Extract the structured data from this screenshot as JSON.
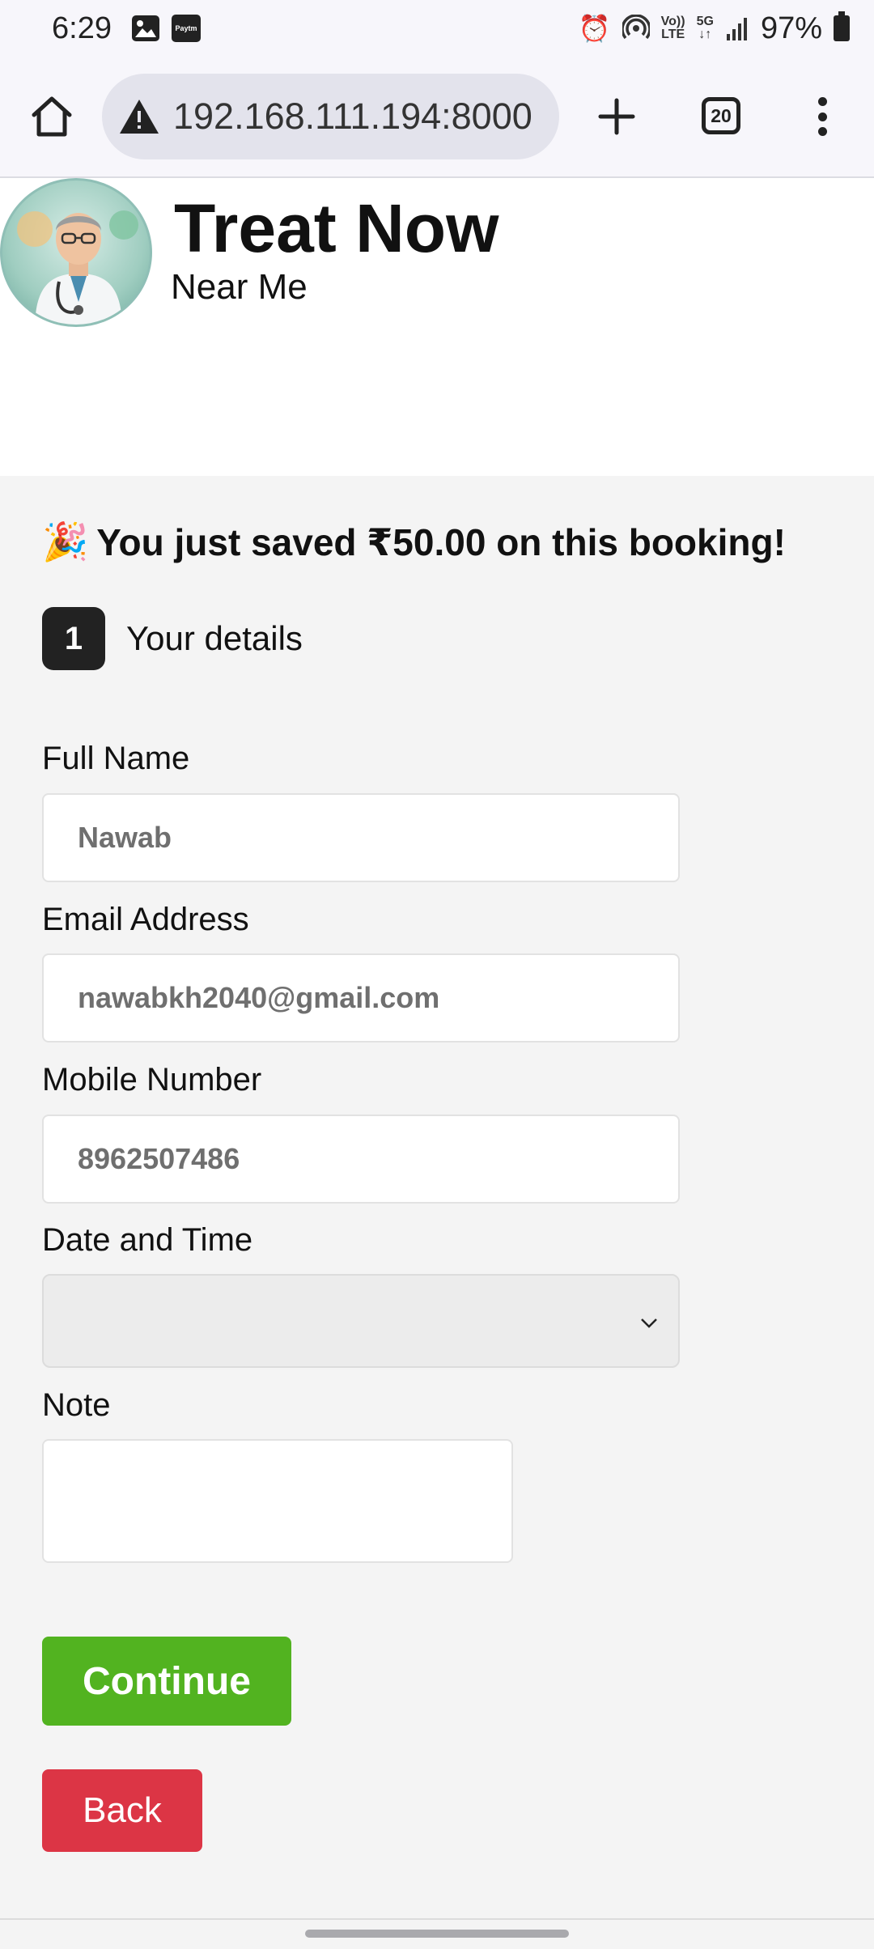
{
  "status_bar": {
    "time": "6:29",
    "icons_left": [
      "image-icon",
      "paytm-icon"
    ],
    "paytm_label": "Paytm",
    "net_top": "Vo))",
    "net_bottom": "LTE",
    "net2_top": "5G",
    "net2_bottom": "↓↑",
    "battery_percent": "97%"
  },
  "browser": {
    "url": "192.168.111.194:8000",
    "tab_count": "20"
  },
  "header": {
    "title": "Treat Now",
    "subtitle": "Near Me"
  },
  "promo": {
    "icon": "🎉",
    "text": "You just saved ₹50.00 on this booking!"
  },
  "step": {
    "number": "1",
    "label": "Your details"
  },
  "form": {
    "full_name_label": "Full Name",
    "full_name_value": "Nawab",
    "email_label": "Email Address",
    "email_value": "nawabkh2040@gmail.com",
    "mobile_label": "Mobile Number",
    "mobile_value": "8962507486",
    "datetime_label": "Date and Time",
    "note_label": "Note"
  },
  "buttons": {
    "continue": "Continue",
    "back": "Back"
  }
}
